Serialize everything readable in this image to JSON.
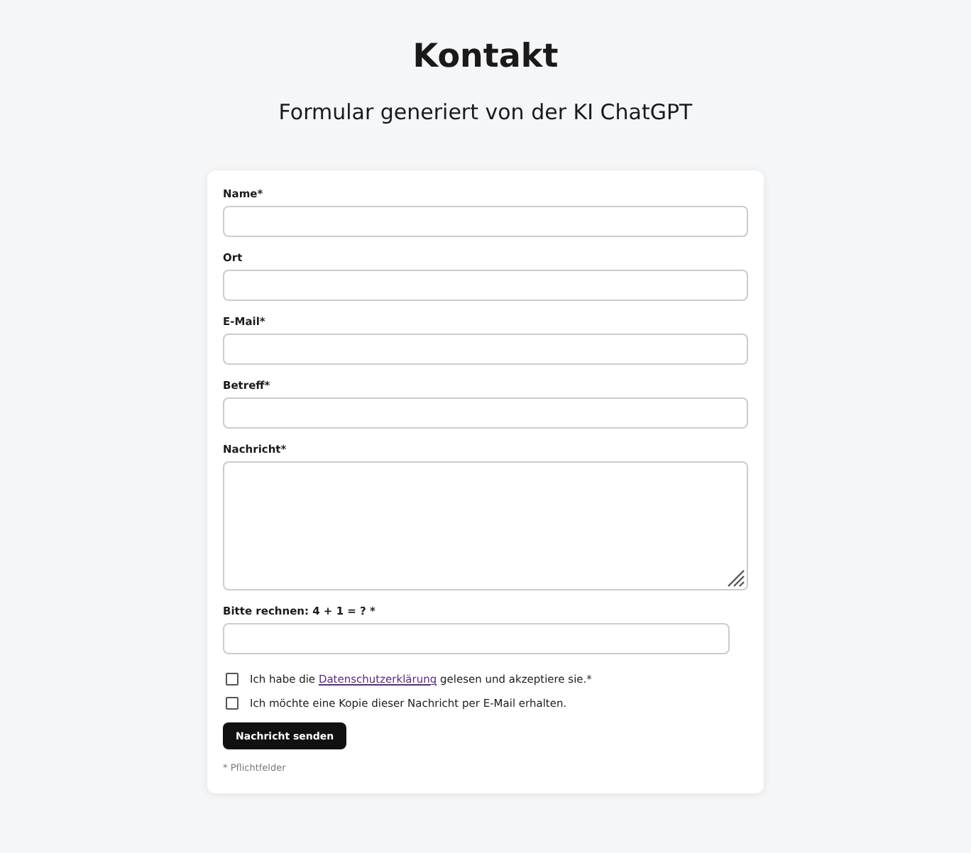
{
  "page": {
    "title": "Kontakt",
    "subtitle": "Formular generiert von der KI ChatGPT"
  },
  "form": {
    "fields": [
      {
        "kind": "input",
        "label": "Name*"
      },
      {
        "kind": "input",
        "label": "Ort"
      },
      {
        "kind": "input",
        "label": "E-Mail*"
      },
      {
        "kind": "input",
        "label": "Betreff*"
      },
      {
        "kind": "textarea",
        "label": "Nachricht*"
      }
    ],
    "captcha": {
      "label": "Bitte rechnen: 4 + 1 = ? *"
    },
    "checkboxes": [
      {
        "text_before": "Ich habe die ",
        "link": "Datenschutzerklärung",
        "text_after": " gelesen und akzeptiere sie.*",
        "checked": false
      },
      {
        "text_before": "Ich möchte eine Kopie dieser Nachricht per E-Mail erhalten.",
        "checked": false
      }
    ],
    "submit": "Nachricht senden",
    "footnote": "* Pflichtfelder"
  }
}
